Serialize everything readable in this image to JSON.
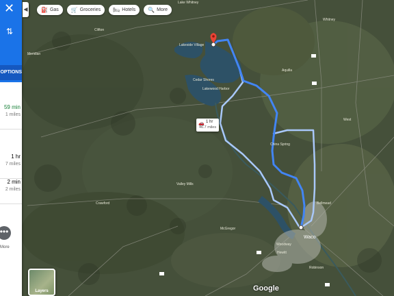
{
  "chips": [
    {
      "icon": "gas-station-icon",
      "glyph": "⛽",
      "label": "Gas"
    },
    {
      "icon": "grocery-cart-icon",
      "glyph": "🛒",
      "label": "Groceries"
    },
    {
      "icon": "hotel-bed-icon",
      "glyph": "🛏",
      "label": "Hotels"
    },
    {
      "icon": "search-icon",
      "glyph": "🔍",
      "label": "More"
    }
  ],
  "panel": {
    "close_glyph": "✕",
    "options_label": "OPTIONS",
    "routes": [
      {
        "time": "59 min",
        "distance": "1 miles"
      },
      {
        "time": "1 hr",
        "distance": "7 miles"
      },
      {
        "time": "2 min",
        "distance": "2 miles"
      }
    ],
    "more_label": "More"
  },
  "route_label": {
    "time": "1 hr",
    "distance": "46.7 miles"
  },
  "places": [
    "Lakeside Village",
    "Cedar Shores",
    "Lakewood Harbor",
    "Whitney",
    "Lake Whitney",
    "Clifton",
    "Meridian",
    "Valley Mills",
    "China Spring",
    "Crawford",
    "McGregor",
    "Hewitt",
    "Woodway",
    "Robinson",
    "Waco",
    "Bellmead",
    "West",
    "Aquilla"
  ],
  "layers_label": "Layers",
  "attribution": "Google",
  "colors": {
    "route_primary": "#4285f4",
    "route_alt": "#a9c8fa",
    "pin": "#ea4335",
    "water": "#2d5166"
  }
}
